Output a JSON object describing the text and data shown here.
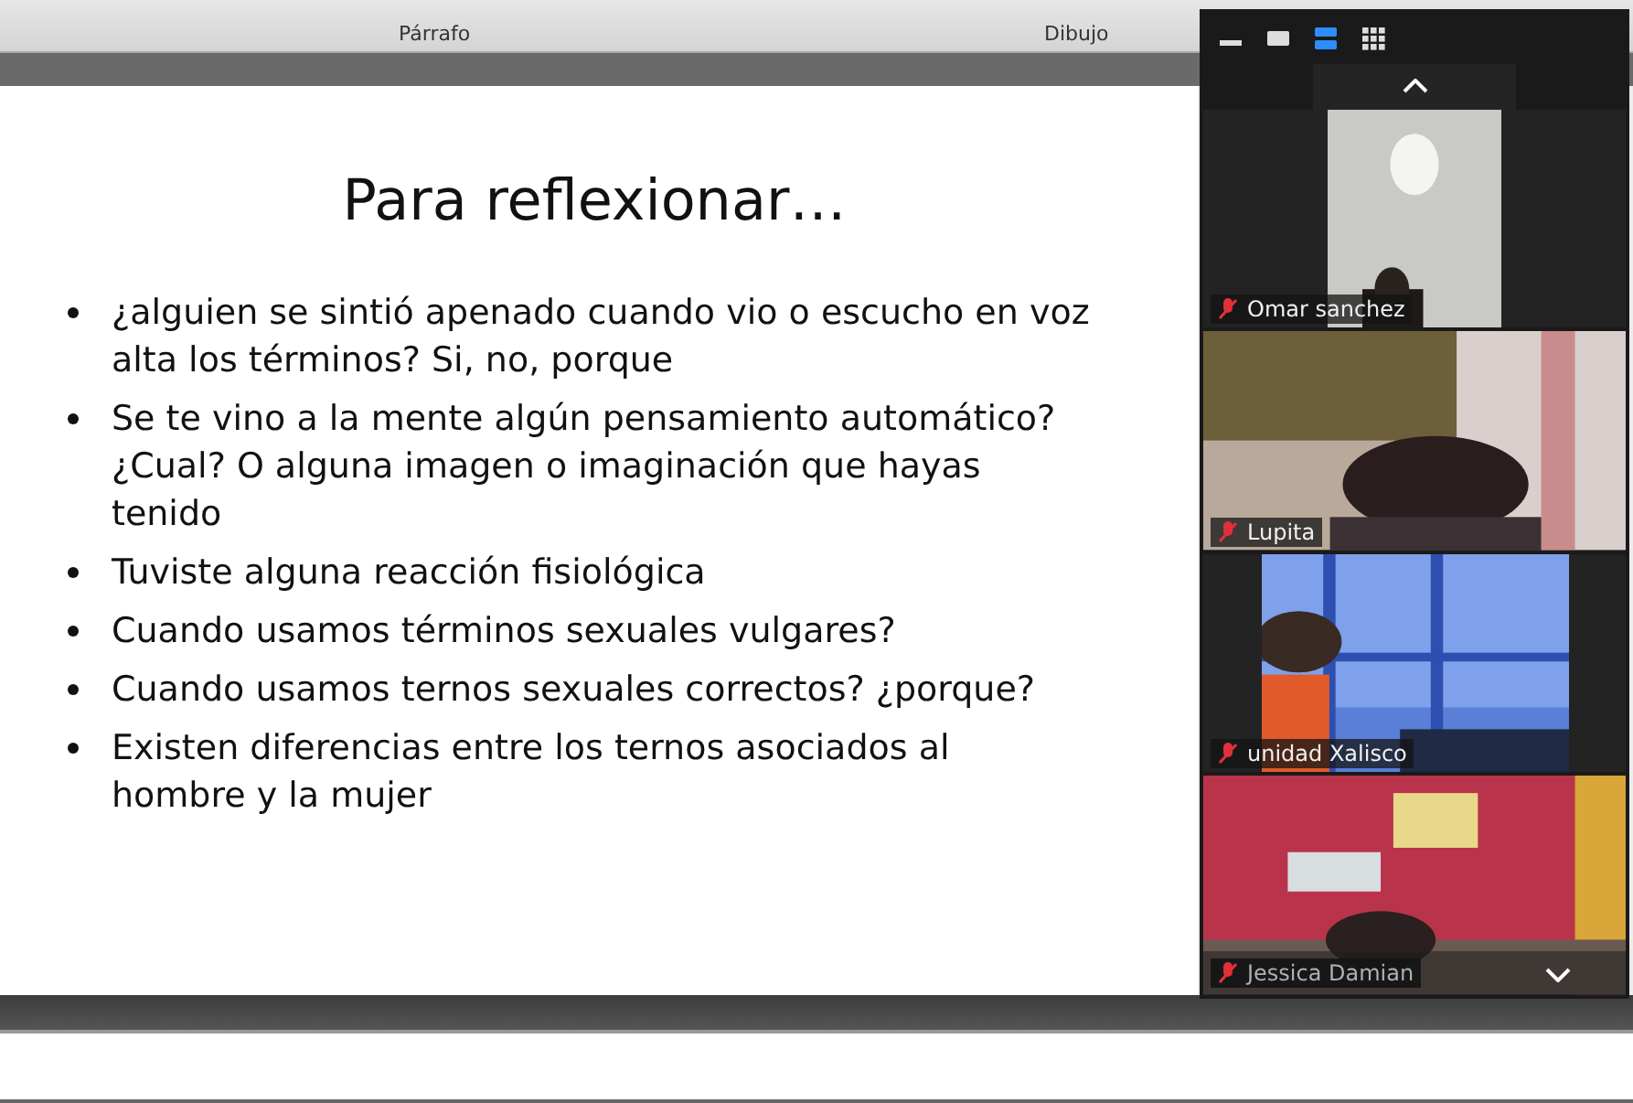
{
  "ribbon": {
    "groups": [
      {
        "label": "Párrafo"
      },
      {
        "label": "Dibujo"
      }
    ]
  },
  "slide": {
    "title": "Para reflexionar…",
    "bullets": [
      "¿alguien se sintió apenado cuando vio o escucho en voz alta los términos? Si, no, porque",
      "Se te vino a la mente algún pensamiento automático? ¿Cual? O alguna imagen o imaginación que hayas tenido",
      "Tuviste alguna reacción fisiológica",
      "Cuando usamos términos sexuales vulgares?",
      "Cuando usamos ternos sexuales correctos? ¿porque?",
      "Existen diferencias entre los ternos asociados al hombre y la mujer"
    ]
  },
  "video_panel": {
    "view_buttons": [
      {
        "kind": "minimize",
        "selected": false
      },
      {
        "kind": "speaker",
        "selected": false
      },
      {
        "kind": "strip",
        "selected": true
      },
      {
        "kind": "gallery",
        "selected": false
      }
    ],
    "participants": [
      {
        "name": "Omar sanchez",
        "muted": true,
        "kind": "narrow"
      },
      {
        "name": "Lupita",
        "muted": true,
        "kind": "wide"
      },
      {
        "name": "unidad Xalisco",
        "muted": true,
        "kind": "medium"
      },
      {
        "name": "Jessica Damian",
        "muted": true,
        "kind": "wide"
      }
    ]
  }
}
